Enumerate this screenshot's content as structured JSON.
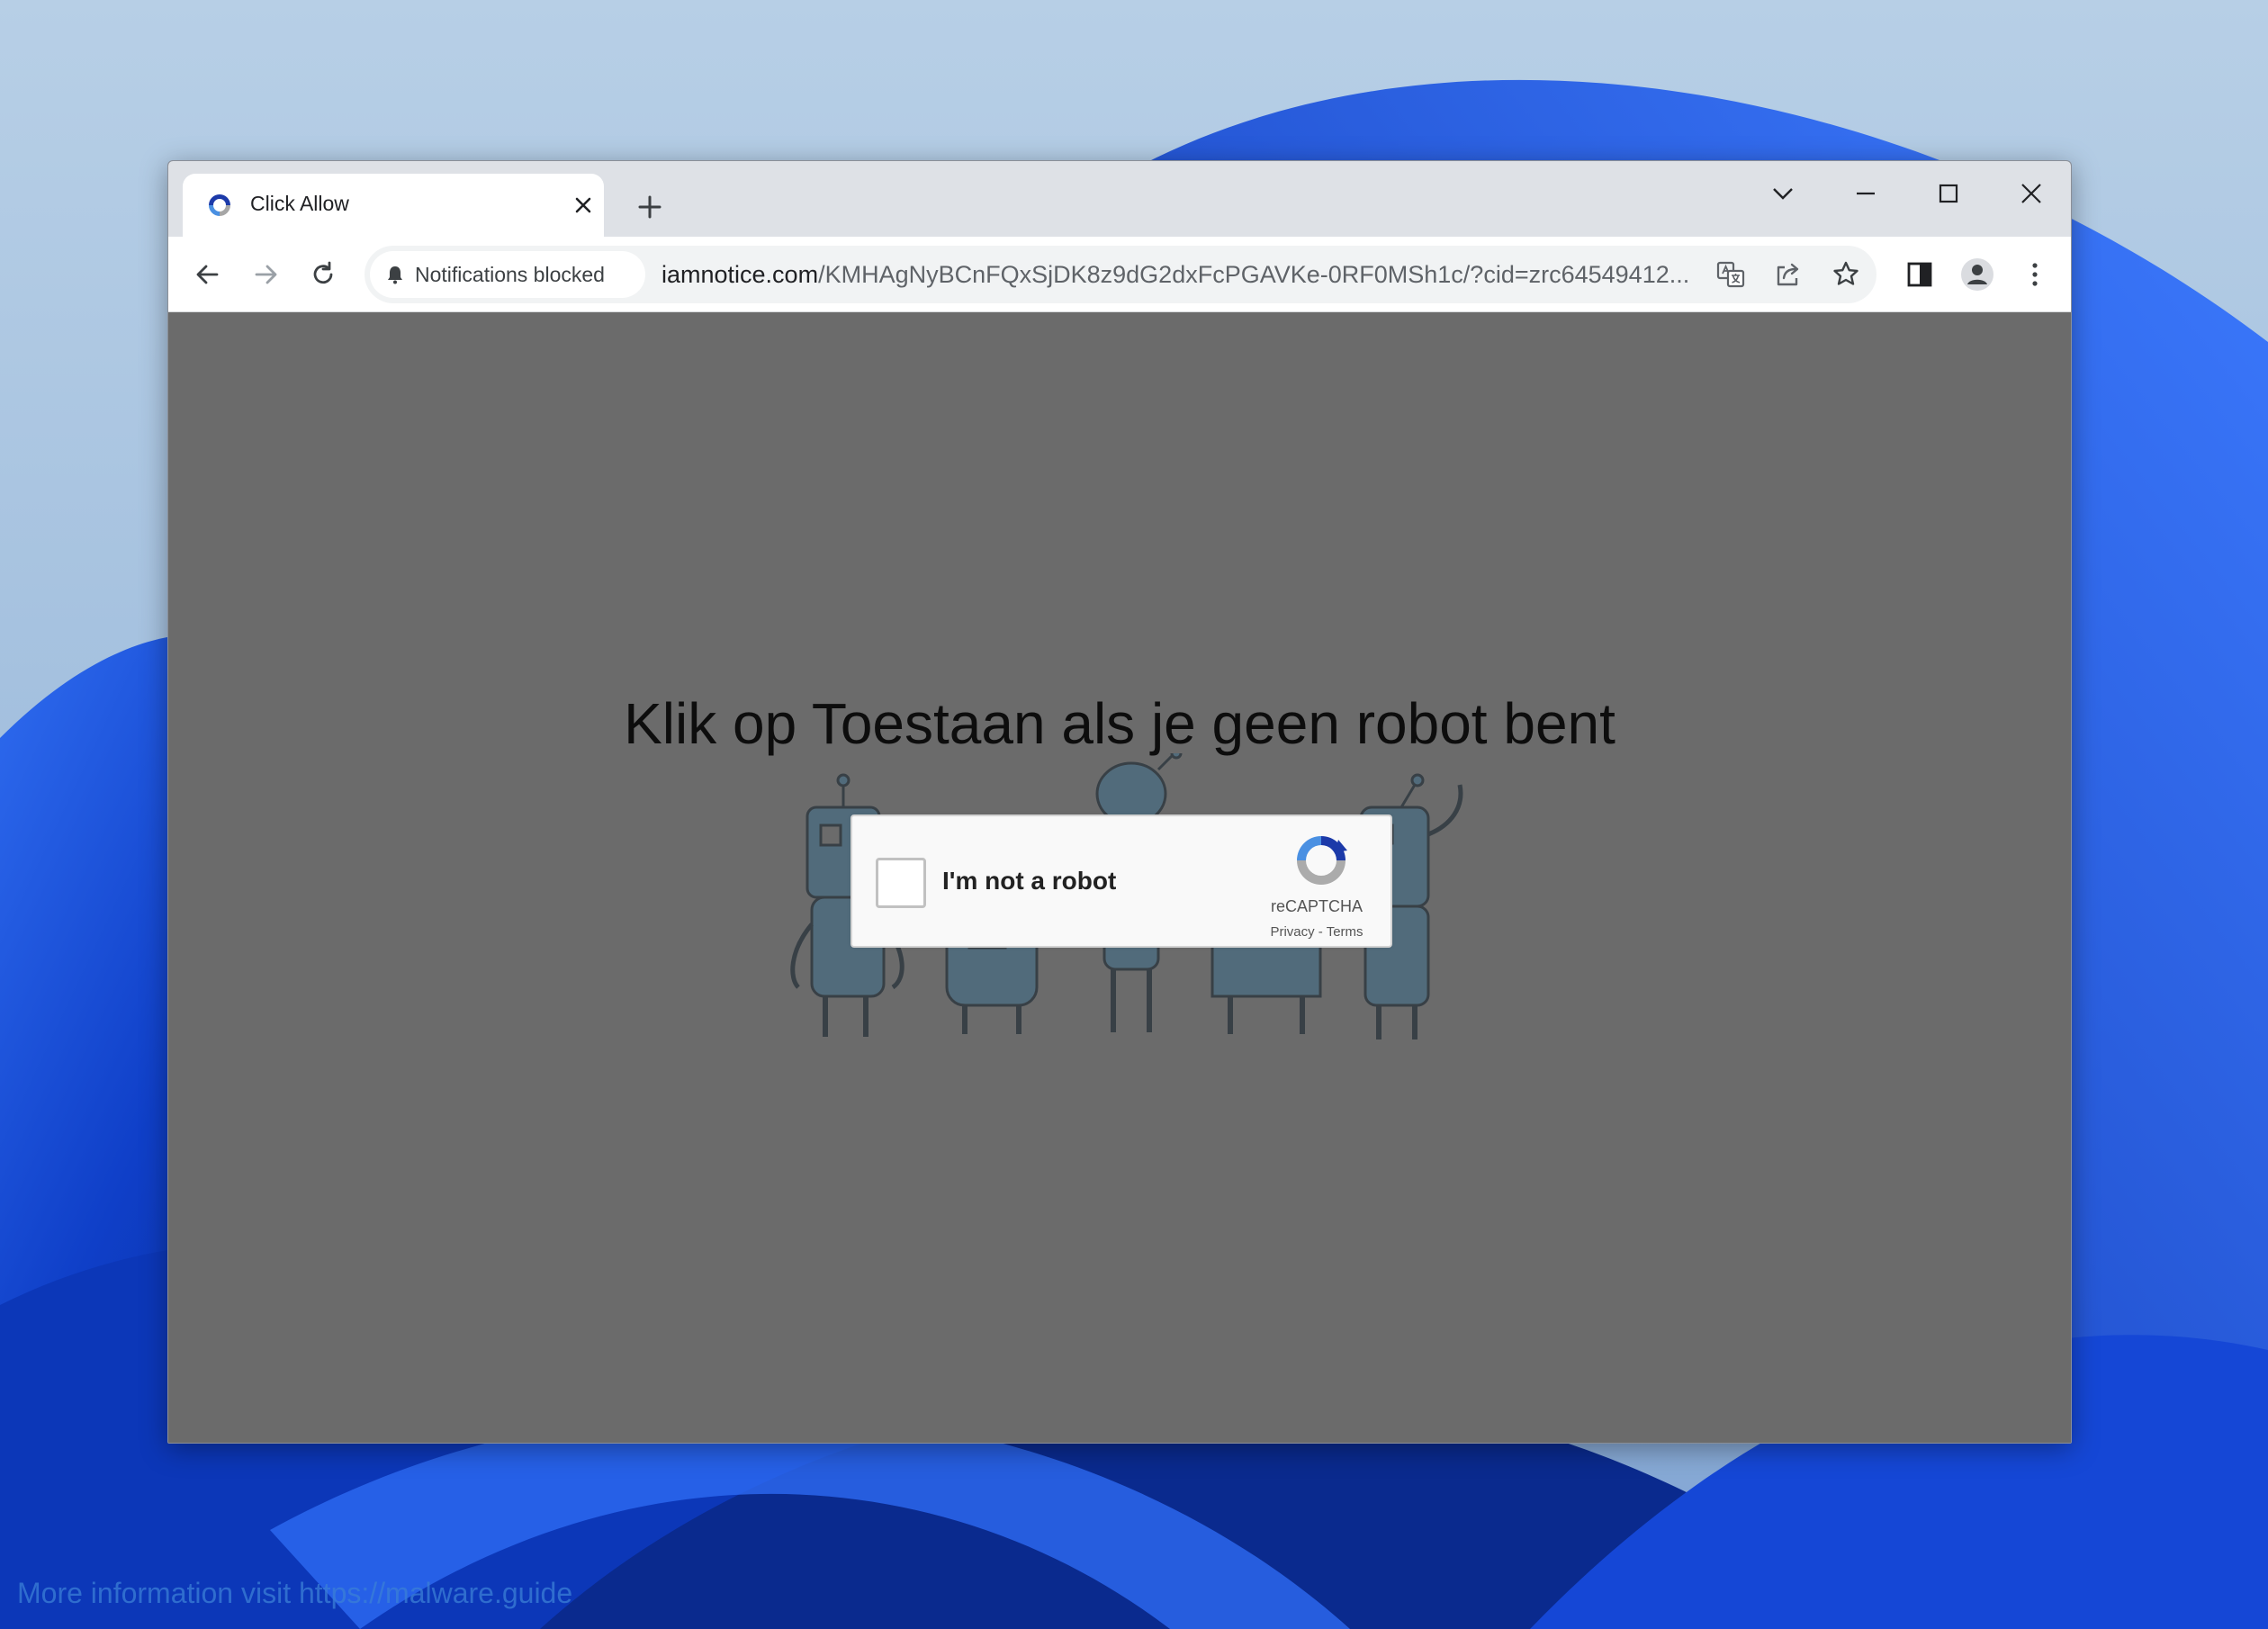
{
  "tab": {
    "title": "Click Allow"
  },
  "omnibox": {
    "chip_label": "Notifications blocked",
    "url_host": "iamnotice.com",
    "url_path": "/KMHAgNyBCnFQxSjDK8z9dG2dxFcPGAVKe-0RF0MSh1c/?cid=zrc64549412..."
  },
  "page": {
    "headline": "Klik op Toestaan als je geen robot bent"
  },
  "captcha": {
    "label": "I'm not a robot",
    "brand": "reCAPTCHA",
    "privacy": "Privacy",
    "separator": " - ",
    "terms": "Terms",
    "checked": false
  },
  "watermark": "More information visit https://malware.guide",
  "colors": {
    "page_overlay": "#6b6b6b",
    "tabstrip": "#dee1e6",
    "wallpaper_blue": "#1a4fd6",
    "recaptcha_blue": "#1c3aa9"
  },
  "icons": {
    "back": "arrow-left-icon",
    "forward": "arrow-right-icon",
    "reload": "reload-icon",
    "bell": "bell-icon",
    "translate": "translate-icon",
    "share": "share-icon",
    "bookmark": "star-icon",
    "side_panel": "side-panel-icon",
    "profile": "avatar-icon",
    "menu": "kebab-menu-icon"
  }
}
